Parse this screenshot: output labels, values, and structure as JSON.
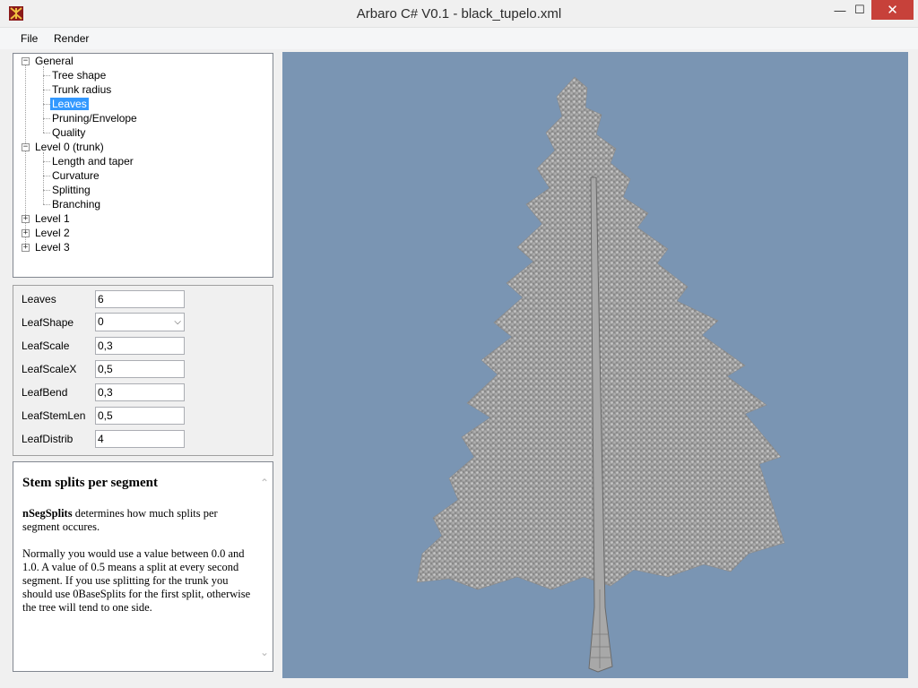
{
  "window": {
    "title": "Arbaro C# V0.1 - black_tupelo.xml",
    "minimize": "—",
    "maximize": "☐",
    "close": "✕"
  },
  "menu": {
    "file": "File",
    "render": "Render"
  },
  "tree": {
    "general": "General",
    "tree_shape": "Tree shape",
    "trunk_radius": "Trunk radius",
    "leaves": "Leaves",
    "pruning": "Pruning/Envelope",
    "quality": "Quality",
    "level0": "Level 0 (trunk)",
    "length_taper": "Length and taper",
    "curvature": "Curvature",
    "splitting": "Splitting",
    "branching": "Branching",
    "level1": "Level 1",
    "level2": "Level 2",
    "level3": "Level 3"
  },
  "properties": {
    "leaves": {
      "label": "Leaves",
      "value": "6"
    },
    "leaf_shape": {
      "label": "LeafShape",
      "value": "0"
    },
    "leaf_scale": {
      "label": "LeafScale",
      "value": "0,3"
    },
    "leaf_scale_x": {
      "label": "LeafScaleX",
      "value": "0,5"
    },
    "leaf_bend": {
      "label": "LeafBend",
      "value": "0,3"
    },
    "leaf_stem_len": {
      "label": "LeafStemLen",
      "value": "0,5"
    },
    "leaf_distrib": {
      "label": "LeafDistrib",
      "value": "4"
    }
  },
  "help": {
    "title": "Stem splits per segment",
    "term": "nSegSplits",
    "p1_rest": " determines how much splits per segment occures.",
    "p2": "Normally you would use a value between 0.0 and 1.0. A value of 0.5 means a split at every second segment. If you use splitting for the trunk you should use 0BaseSplits for the first split, otherwise the tree will tend to one side."
  },
  "colors": {
    "viewport_bg": "#7a95b3",
    "selection": "#3399ff",
    "close_button": "#c7413a"
  }
}
